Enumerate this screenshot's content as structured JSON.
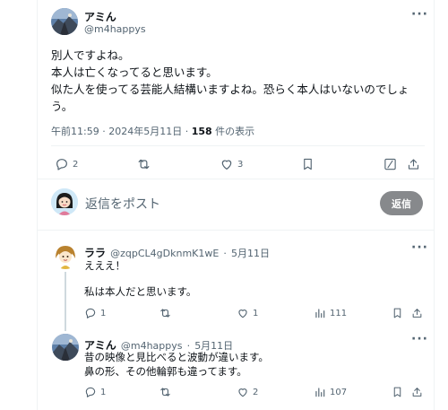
{
  "main_post": {
    "display_name": "アミん",
    "handle": "@m4happys",
    "lines": [
      "別人ですよね。",
      "本人は亡くなってると思います。",
      "似た人を使ってる芸能人結構いますよね。恐らく本人はいないのでしょ",
      "う。"
    ],
    "time": "午前11:59",
    "date": "2024年5月11日",
    "views_count": "158",
    "views_label": "件の表示",
    "actions": {
      "reply_count": "2",
      "like_count": "3"
    }
  },
  "reply_composer": {
    "placeholder": "返信をポスト",
    "button_label": "返信"
  },
  "replies": [
    {
      "display_name": "ララ",
      "handle": "@zqpCL4gDknmK1wE",
      "date": "5月11日",
      "lines": [
        "えええ！",
        "",
        "私は本人だと思います。"
      ],
      "reply_count": "1",
      "like_count": "1",
      "views_count": "111"
    },
    {
      "display_name": "アミん",
      "handle": "@m4happys",
      "date": "5月11日",
      "lines": [
        "昔の映像と見比べると波動が違います。",
        "鼻の形、その他輪郭も違ってます。"
      ],
      "reply_count": "1",
      "like_count": "2",
      "views_count": "107"
    }
  ],
  "separator": "·",
  "more_glyph": "···",
  "colors": {
    "accent": "#1d9bf0",
    "muted": "#536471",
    "button": "#87898c",
    "divider": "#eff3f4"
  }
}
